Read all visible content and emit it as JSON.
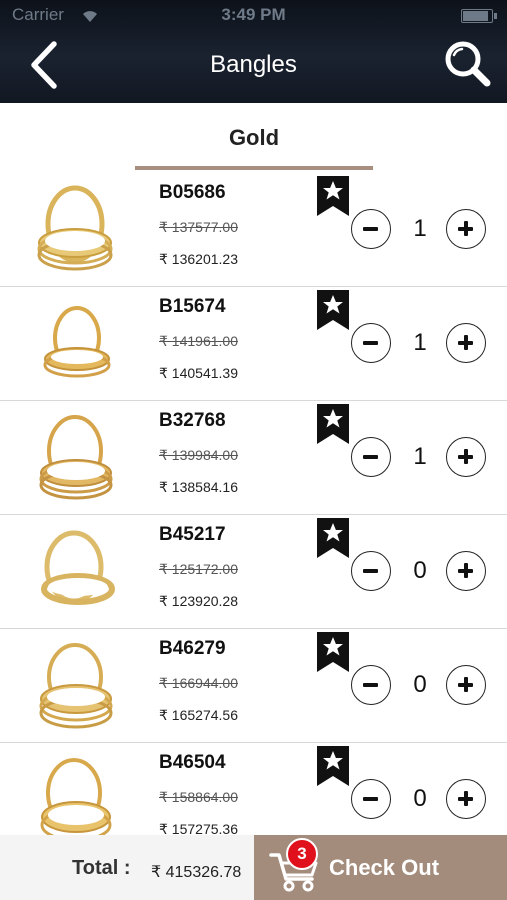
{
  "status_bar": {
    "carrier": "Carrier",
    "time": "3:49 PM"
  },
  "header": {
    "title": "Bangles",
    "back_icon": "back-arrow-icon",
    "search_icon": "search-icon"
  },
  "tabs": [
    {
      "label": "Gold",
      "selected": true
    }
  ],
  "currency_symbol": "₹",
  "products": [
    {
      "code": "B05686",
      "old_price": "₹ 137577.00",
      "price": "₹ 136201.23",
      "qty": "1"
    },
    {
      "code": "B15674",
      "old_price": "₹ 141961.00",
      "price": "₹ 140541.39",
      "qty": "1"
    },
    {
      "code": "B32768",
      "old_price": "₹ 139984.00",
      "price": "₹ 138584.16",
      "qty": "1"
    },
    {
      "code": "B45217",
      "old_price": "₹ 125172.00",
      "price": "₹ 123920.28",
      "qty": "0"
    },
    {
      "code": "B46279",
      "old_price": "₹ 166944.00",
      "price": "₹ 165274.56",
      "qty": "0"
    },
    {
      "code": "B46504",
      "old_price": "₹ 158864.00",
      "price": "₹ 157275.36",
      "qty": "0"
    }
  ],
  "footer": {
    "total_label": "Total :",
    "total_value": "₹ 415326.78",
    "cart_count": "3",
    "checkout_label": "Check Out"
  },
  "colors": {
    "header_bg": "#151b26",
    "tab_underline": "#a88f80",
    "checkout_bg": "#a48c7d",
    "badge": "#e0111c",
    "gold": "#d9b45a"
  }
}
